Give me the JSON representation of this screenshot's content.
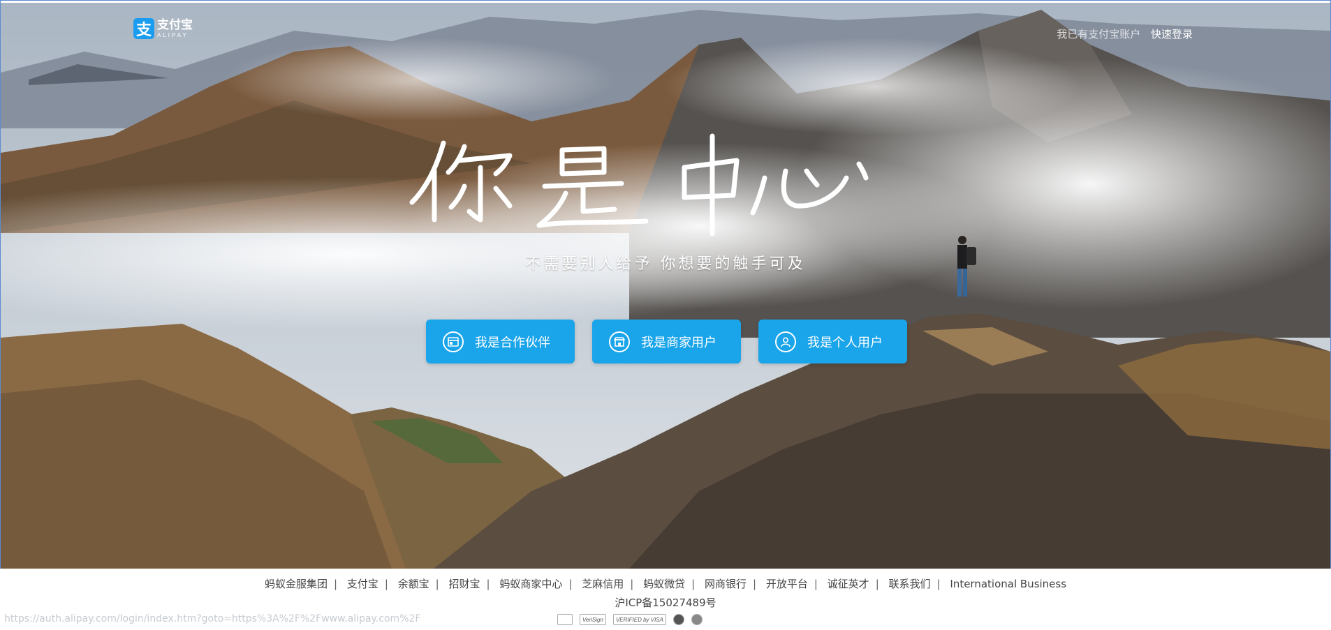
{
  "logo": {
    "mark": "支",
    "name": "支付宝",
    "name_en": "ALIPAY"
  },
  "header": {
    "existing_user_text": "我已有支付宝账户",
    "login_link": "快速登录"
  },
  "hero": {
    "headline": "你是中心",
    "subline": "不需要别人给予  你想要的触手可及"
  },
  "buttons": [
    {
      "label": "我是合作伙伴",
      "icon": "partner-card-icon"
    },
    {
      "label": "我是商家用户",
      "icon": "shop-icon"
    },
    {
      "label": "我是个人用户",
      "icon": "user-icon"
    }
  ],
  "footer": {
    "links": [
      "蚂蚁金服集团",
      "支付宝",
      "余额宝",
      "招财宝",
      "蚂蚁商家中心",
      "芝麻信用",
      "蚂蚁微贷",
      "网商银行",
      "开放平台",
      "诚征英才",
      "联系我们",
      "International Business"
    ],
    "icp": "沪ICP备15027489号",
    "status_url": "https://auth.alipay.com/login/index.htm?goto=https%3A%2F%2Fwww.alipay.com%2F",
    "badges": [
      "",
      "VeriSign",
      "VERIFIED by VISA",
      "",
      ""
    ]
  },
  "colors": {
    "accent": "#1aa4ea",
    "logo_blue": "#1a9df0"
  }
}
